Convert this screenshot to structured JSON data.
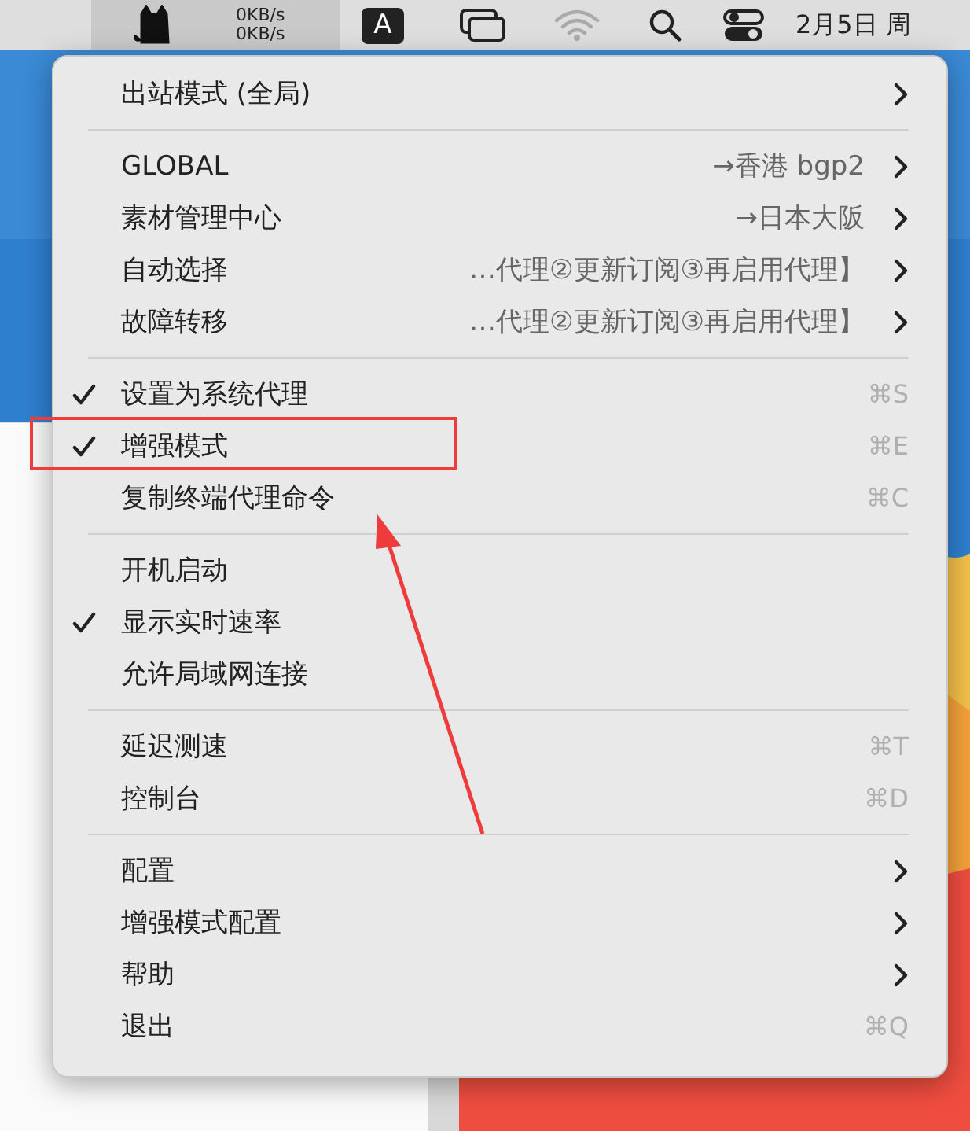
{
  "menubar": {
    "speed_up": "0KB/s",
    "speed_down": "0KB/s",
    "input_method": "A",
    "clock": "2月5日 周"
  },
  "menu": {
    "sections": [
      [
        {
          "kind": "submenu",
          "label": "出站模式 (全局)"
        }
      ],
      [
        {
          "kind": "submenu",
          "label": "GLOBAL",
          "detail": "→香港 bgp2"
        },
        {
          "kind": "submenu",
          "label": "素材管理中心",
          "detail": "→日本大阪"
        },
        {
          "kind": "submenu",
          "label": "自动选择",
          "detail": "…代理②更新订阅③再启用代理】"
        },
        {
          "kind": "submenu",
          "label": "故障转移",
          "detail": "…代理②更新订阅③再启用代理】"
        }
      ],
      [
        {
          "kind": "toggle",
          "label": "设置为系统代理",
          "shortcut": "⌘S",
          "checked": true,
          "highlighted": false
        },
        {
          "kind": "toggle",
          "label": "增强模式",
          "shortcut": "⌘E",
          "checked": true,
          "highlighted": true
        },
        {
          "kind": "toggle",
          "label": "复制终端代理命令",
          "shortcut": "⌘C",
          "checked": false,
          "highlighted": false
        }
      ],
      [
        {
          "kind": "toggle",
          "label": "开机启动",
          "checked": false,
          "highlighted": false
        },
        {
          "kind": "toggle",
          "label": "显示实时速率",
          "checked": true,
          "highlighted": false
        },
        {
          "kind": "toggle",
          "label": "允许局域网连接",
          "checked": false,
          "highlighted": false
        }
      ],
      [
        {
          "kind": "command",
          "label": "延迟测速",
          "shortcut": "⌘T"
        },
        {
          "kind": "command",
          "label": "控制台",
          "shortcut": "⌘D"
        }
      ],
      [
        {
          "kind": "submenu",
          "label": "配置"
        },
        {
          "kind": "submenu",
          "label": "增强模式配置"
        },
        {
          "kind": "submenu",
          "label": "帮助"
        },
        {
          "kind": "command",
          "label": "退出",
          "shortcut": "⌘Q"
        }
      ]
    ]
  }
}
